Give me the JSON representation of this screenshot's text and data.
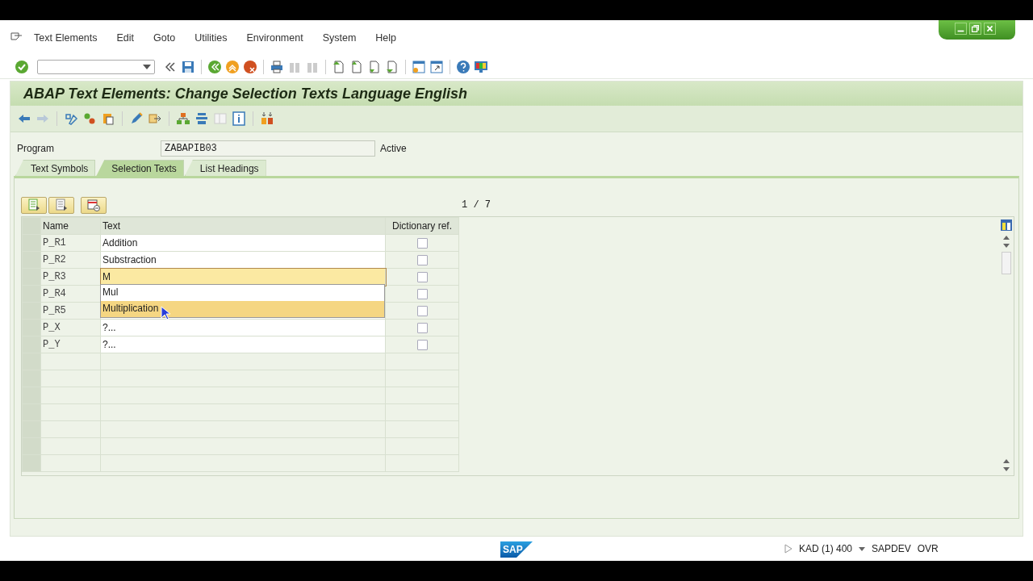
{
  "menu": [
    {
      "label": "Text Elements"
    },
    {
      "label": "Edit"
    },
    {
      "label": "Goto"
    },
    {
      "label": "Utilities"
    },
    {
      "label": "Environment"
    },
    {
      "label": "System"
    },
    {
      "label": "Help"
    }
  ],
  "title": "ABAP Text Elements: Change Selection Texts Language English",
  "program": {
    "label": "Program",
    "value": "ZABAPIB03",
    "status": "Active"
  },
  "tabs": [
    {
      "label": "Text Symbols",
      "selected": false
    },
    {
      "label": "Selection Texts",
      "selected": true
    },
    {
      "label": "List Headings",
      "selected": false
    }
  ],
  "page_indicator": "1 / 7",
  "table": {
    "columns": [
      "Name",
      "Text",
      "Dictionary ref."
    ],
    "rows": [
      {
        "name": "P_R1",
        "text": "Addition",
        "editing": false,
        "dictionary_ref": false
      },
      {
        "name": "P_R2",
        "text": "Substraction",
        "editing": false,
        "dictionary_ref": false
      },
      {
        "name": "P_R3",
        "text": "M",
        "editing": true,
        "dictionary_ref": false
      },
      {
        "name": "P_R4",
        "editing": false,
        "dictionary_ref": false
      },
      {
        "name": "P_R5",
        "editing": false,
        "dictionary_ref": false
      },
      {
        "name": "P_X",
        "text": "?...",
        "editing": false,
        "dictionary_ref": false
      },
      {
        "name": "P_Y",
        "text": "?...",
        "editing": false,
        "dictionary_ref": false
      }
    ]
  },
  "suggestions": [
    {
      "label": "Mul",
      "selected": false
    },
    {
      "label": "Multiplication",
      "selected": true
    }
  ],
  "status_bar": {
    "logo": "SAP",
    "system": "KAD (1) 400",
    "server": "SAPDEV",
    "mode": "OVR"
  }
}
